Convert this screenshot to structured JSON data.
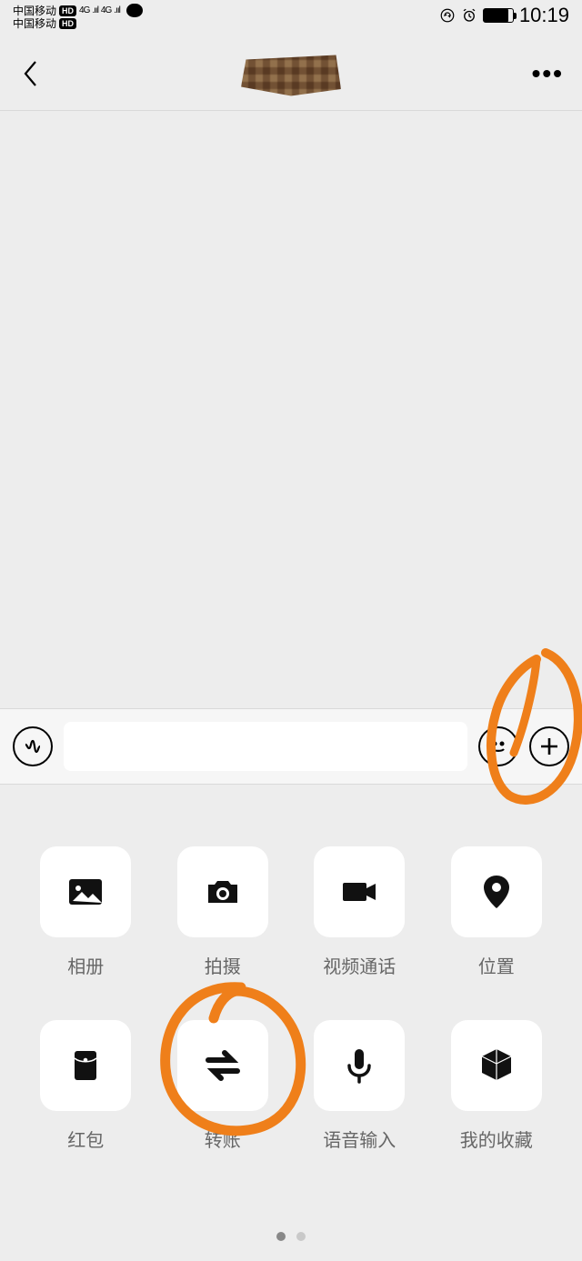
{
  "status": {
    "carrier1": "中国移动",
    "carrier2": "中国移动",
    "hd": "HD",
    "net": "4G",
    "time": "10:19"
  },
  "nav": {
    "more": "•••"
  },
  "panel": {
    "items": [
      {
        "label": "相册"
      },
      {
        "label": "拍摄"
      },
      {
        "label": "视频通话"
      },
      {
        "label": "位置"
      },
      {
        "label": "红包"
      },
      {
        "label": "转账"
      },
      {
        "label": "语音输入"
      },
      {
        "label": "我的收藏"
      }
    ]
  }
}
